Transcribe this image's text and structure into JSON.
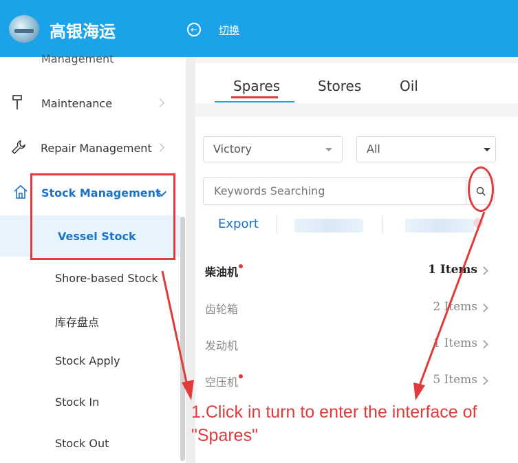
{
  "header": {
    "app_title": "高银海运",
    "switch_label": "切换",
    "collapse_icon": "circle-left-arrow-icon"
  },
  "sidebar": {
    "partial_item": "Management",
    "items": [
      {
        "label": "Maintenance",
        "icon": "hammer-icon"
      },
      {
        "label": "Repair Management",
        "icon": "wrench-icon"
      },
      {
        "label": "Stock Management",
        "icon": "home-icon",
        "expanded": true
      }
    ],
    "sub_items": [
      {
        "label": "Vessel Stock",
        "selected": true
      },
      {
        "label": "Shore-based Stock"
      },
      {
        "label": "库存盘点"
      },
      {
        "label": "Stock Apply"
      },
      {
        "label": "Stock In"
      },
      {
        "label": "Stock Out"
      }
    ]
  },
  "tabs": [
    {
      "label": "Spares",
      "active": true
    },
    {
      "label": "Stores"
    },
    {
      "label": "Oil"
    }
  ],
  "filters": {
    "vessel_select": "Victory",
    "category_select": "All",
    "search_placeholder": "Keywords Searching"
  },
  "actions": {
    "export_label": "Export"
  },
  "rows": [
    {
      "name": "柴油机",
      "count": "1 Items",
      "marked": true,
      "bold": true
    },
    {
      "name": "齿轮箱",
      "count": "2 Items",
      "marked": false,
      "bold": false
    },
    {
      "name": "发动机",
      "count": "1 Items",
      "marked": false,
      "bold": false
    },
    {
      "name": "空压机",
      "count": "5 Items",
      "marked": true,
      "bold": false
    }
  ],
  "annotation": {
    "text": "1.Click in turn to enter the interface of \"Spares\""
  },
  "colors": {
    "header_bg": "#1aa3e8",
    "accent_blue": "#1a73c8",
    "annotation_red": "#e03a3a",
    "selected_bg": "#e8f4fd"
  }
}
